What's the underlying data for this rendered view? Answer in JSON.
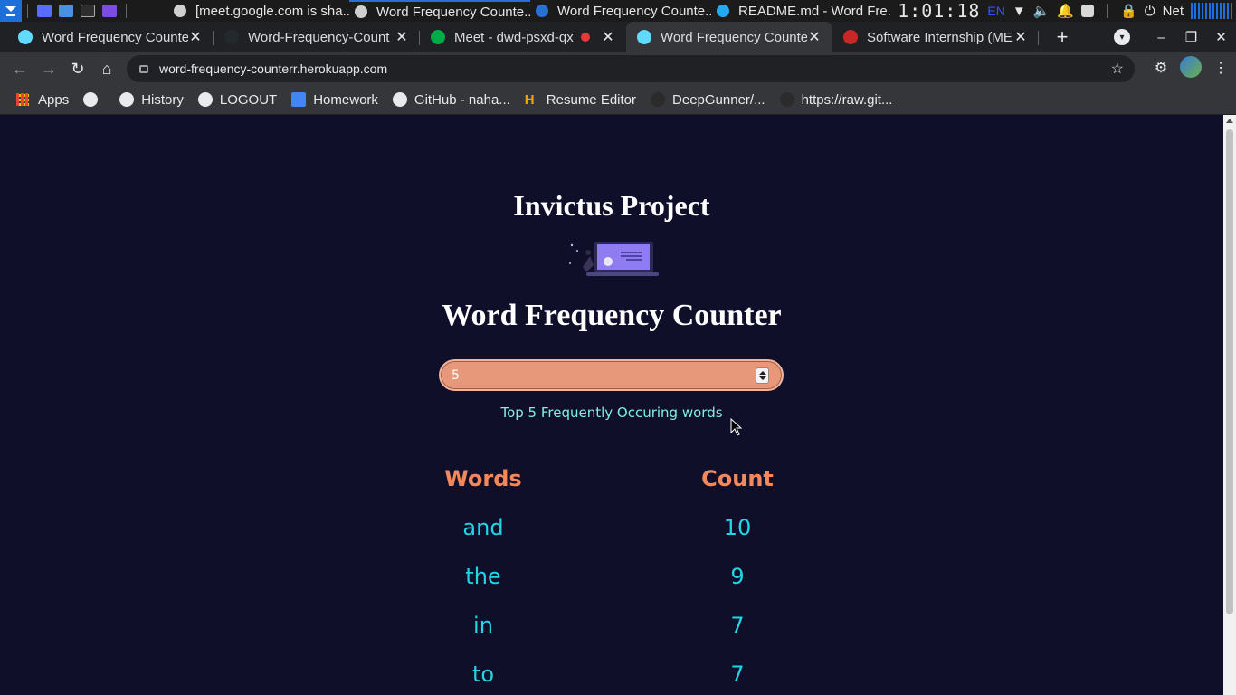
{
  "taskbar": {
    "windows": [
      {
        "label": "[meet.google.com is sha...",
        "color": "#cfcfcf",
        "active": false
      },
      {
        "label": "Word Frequency Counte...",
        "color": "#cfcfcf",
        "active": true
      },
      {
        "label": "Word Frequency Counte...",
        "color": "#2a6fd6",
        "active": false
      },
      {
        "label": "README.md - Word Fre...",
        "color": "#23a9f2",
        "active": false
      }
    ],
    "clock": "1:01:18",
    "lang": "EN",
    "net_label": "Net"
  },
  "tabs": [
    {
      "label": "Word Frequency Counte",
      "favicon": "#61dafb",
      "active": false,
      "recording": false
    },
    {
      "label": "Word-Frequency-Count",
      "favicon": "#24292e",
      "active": false,
      "recording": false
    },
    {
      "label": "Meet - dwd-psxd-qx",
      "favicon": "#00ac47",
      "active": false,
      "recording": true
    },
    {
      "label": "Word Frequency Counte",
      "favicon": "#61dafb",
      "active": true,
      "recording": false
    },
    {
      "label": "Software Internship (ME",
      "favicon": "#c62828",
      "active": false,
      "recording": false
    }
  ],
  "toolbar": {
    "url": "word-frequency-counterr.herokuapp.com"
  },
  "bookmarks": [
    {
      "label": "Apps",
      "icon": "apps-grid-icon",
      "color": "#ea4335"
    },
    {
      "label": "",
      "icon": "globe-icon",
      "color": "#e8eaed"
    },
    {
      "label": "History",
      "icon": "history-icon",
      "color": "#e8eaed"
    },
    {
      "label": "LOGOUT",
      "icon": "globe-icon",
      "color": "#e8eaed"
    },
    {
      "label": "Homework",
      "icon": "docs-icon",
      "color": "#4285f4"
    },
    {
      "label": "GitHub - naha...",
      "icon": "github-icon",
      "color": "#e8eaed"
    },
    {
      "label": "Resume Editor",
      "icon": "h-icon",
      "color": "#f0a500"
    },
    {
      "label": "DeepGunner/...",
      "icon": "github-icon",
      "color": "#2b2b2b"
    },
    {
      "label": "https://raw.git...",
      "icon": "github-icon",
      "color": "#2b2b2b"
    }
  ],
  "page": {
    "project_title": "Invictus Project",
    "app_title": "Word Frequency Counter",
    "input_value": "5",
    "caption": "Top 5 Frequently Occuring words",
    "table": {
      "headers": [
        "Words",
        "Count"
      ],
      "rows": [
        {
          "word": "and",
          "count": "10"
        },
        {
          "word": "the",
          "count": "9"
        },
        {
          "word": "in",
          "count": "7"
        },
        {
          "word": "to",
          "count": "7"
        }
      ]
    }
  },
  "colors": {
    "page_bg": "#0f0f2a",
    "heading": "#f2885c",
    "cell": "#1fd6e6",
    "caption": "#7df0e6",
    "input_bg": "#e8987a"
  }
}
